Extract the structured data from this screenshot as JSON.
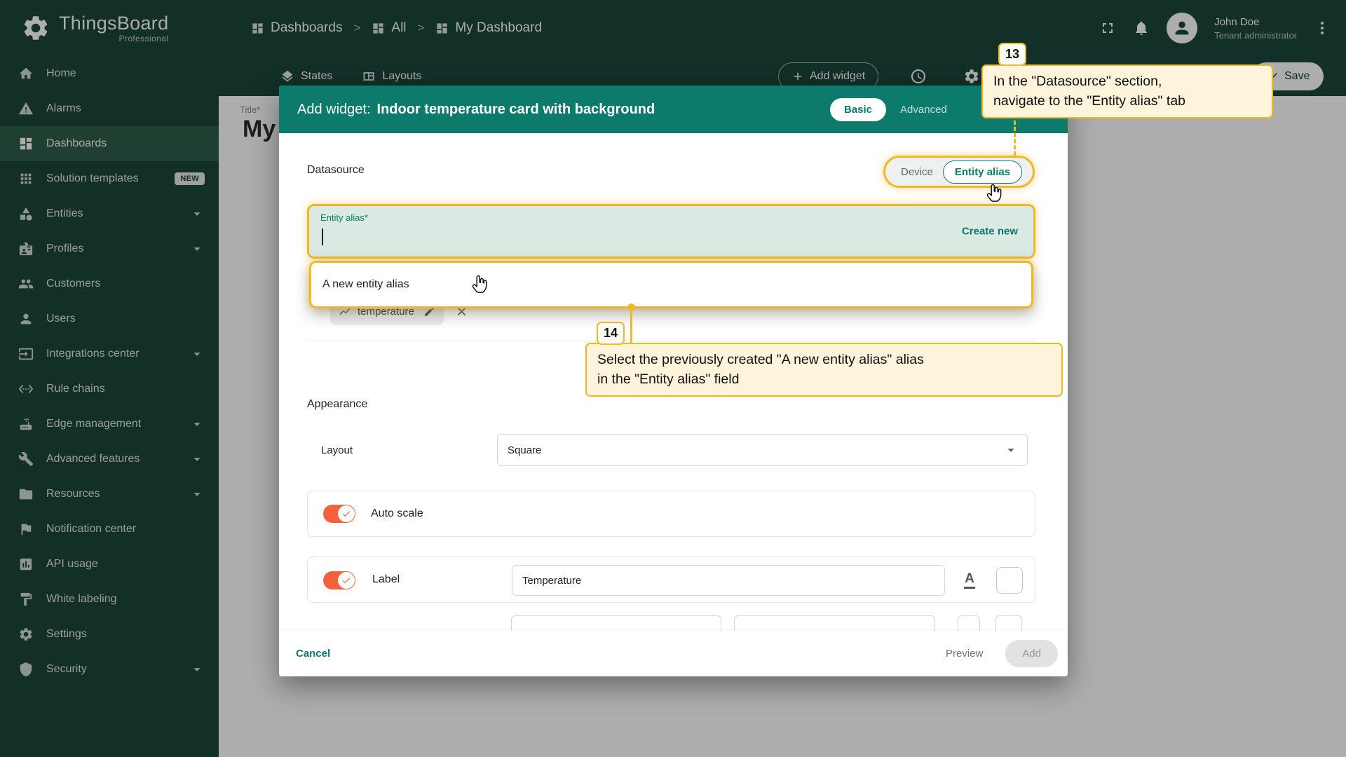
{
  "colors": {
    "sidebar_bg": "#1B463B",
    "sidebar_active_bg": "#2E5D4C",
    "modal_header_bg": "#0C7B6C",
    "accent_teal": "#0B7A6B",
    "toggle_on": "#F3613C",
    "annotation_yellow": "#F0B829",
    "annotation_fill": "#FDF4DB"
  },
  "brand": {
    "name": "ThingsBoard",
    "edition": "Professional"
  },
  "breadcrumb": {
    "separator": ">",
    "items": [
      {
        "label": "Dashboards"
      },
      {
        "label": "All"
      },
      {
        "label": "My Dashboard"
      }
    ]
  },
  "header": {
    "user_name": "John Doe",
    "user_role": "Tenant administrator"
  },
  "dashboard_toolbar": {
    "states": "States",
    "layouts": "Layouts",
    "add_widget": "Add widget",
    "save": "Save"
  },
  "background_page": {
    "title_label": "Title*",
    "title_value": "My"
  },
  "sidebar": {
    "items": [
      {
        "label": "Home"
      },
      {
        "label": "Alarms"
      },
      {
        "label": "Dashboards",
        "active": true
      },
      {
        "label": "Solution templates",
        "badge": "NEW"
      },
      {
        "label": "Entities"
      },
      {
        "label": "Profiles"
      },
      {
        "label": "Customers"
      },
      {
        "label": "Users"
      },
      {
        "label": "Integrations center"
      },
      {
        "label": "Rule chains"
      },
      {
        "label": "Edge management"
      },
      {
        "label": "Advanced features"
      },
      {
        "label": "Resources"
      },
      {
        "label": "Notification center"
      },
      {
        "label": "API usage"
      },
      {
        "label": "White labeling"
      },
      {
        "label": "Settings"
      },
      {
        "label": "Security"
      }
    ]
  },
  "modal": {
    "title_prefix": "Add widget:",
    "title": "Indoor temperature card with background",
    "mode_tabs": {
      "basic": "Basic",
      "advanced": "Advanced",
      "selected": "Basic"
    },
    "datasource": {
      "section_label": "Datasource",
      "type_toggle": {
        "options": [
          "Device",
          "Entity alias"
        ],
        "selected": "Entity alias"
      },
      "entity_alias_label": "Entity alias*",
      "create_new": "Create new",
      "dropdown_option": "A new entity alias",
      "data_key_chip": "temperature"
    },
    "appearance": {
      "section_label": "Appearance",
      "layout_label": "Layout",
      "layout_value": "Square",
      "auto_scale_label": "Auto scale",
      "label_label": "Label",
      "label_value": "Temperature"
    },
    "footer": {
      "cancel": "Cancel",
      "preview": "Preview",
      "add": "Add"
    }
  },
  "annotations": {
    "step13": {
      "number": "13",
      "text": "In the \"Datasource\" section,\nnavigate to the \"Entity alias\" tab"
    },
    "step14": {
      "number": "14",
      "text": "Select the previously created \"A new entity alias\" alias\nin the \"Entity alias\" field"
    }
  }
}
